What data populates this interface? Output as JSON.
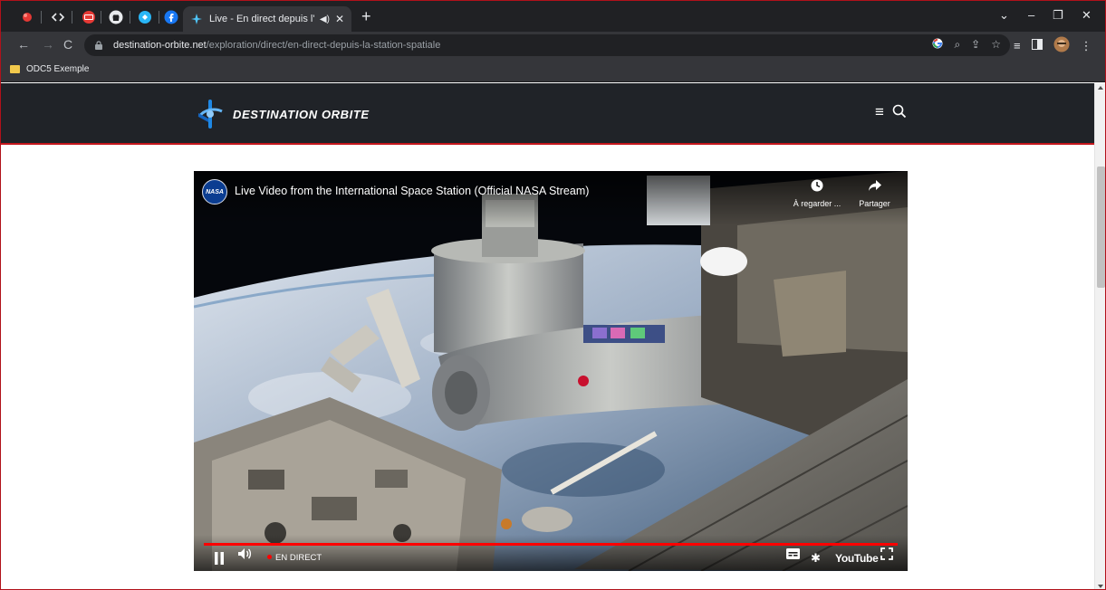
{
  "browser": {
    "active_tab": {
      "title": "Live - En direct depuis l'ISS",
      "audio_icon": "speaker-icon",
      "close_icon": "close-icon"
    },
    "pinned_tabs": [
      "red-app-icon",
      "code-icon",
      "tabs-counter-icon",
      "github-icon",
      "tool-icon",
      "facebook-icon"
    ],
    "url": {
      "host": "destination-orbite.net",
      "path": "/exploration/direct/en-direct-depuis-la-station-spatiale"
    },
    "bookmarks": [
      {
        "label": "ODC5 Exemple",
        "icon": "folder-icon"
      }
    ],
    "colors": {
      "frame": "#202124",
      "toolbar": "#35363a",
      "omnibox": "#202124",
      "border": "#b1111a"
    }
  },
  "site": {
    "name": "DESTINATION ORBITE",
    "accent": "#c4161c",
    "header_bg": "#202328"
  },
  "video": {
    "title": "Live Video from the International Space Station (Official NASA Stream)",
    "channel_avatar_text": "NASA",
    "watch_later": "À regarder ...",
    "share": "Partager",
    "live_label": "EN DIRECT",
    "player_logo": "YouTube",
    "progress_color": "#ff0000"
  }
}
